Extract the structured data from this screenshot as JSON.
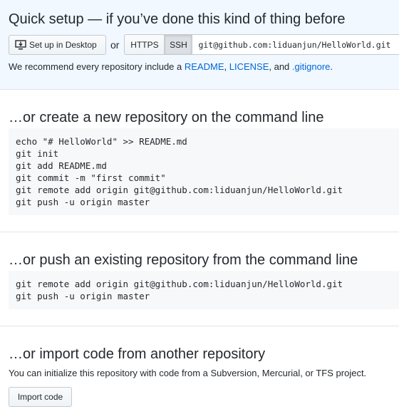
{
  "quick_setup": {
    "title": "Quick setup — if you’ve done this kind of thing before",
    "desktop_button": "Set up in Desktop",
    "or_text": "or",
    "protocols": [
      "HTTPS",
      "SSH"
    ],
    "selected_protocol": "SSH",
    "clone_url": "git@github.com:liduanjun/HelloWorld.git",
    "recommend": {
      "prefix": "We recommend every repository include a ",
      "readme": "README",
      "sep1": ", ",
      "license": "LICENSE",
      "sep2": ", and ",
      "gitignore": ".gitignore",
      "suffix": "."
    }
  },
  "create_section": {
    "title": "…or create a new repository on the command line",
    "lines": [
      "echo \"# HelloWorld\" >> README.md",
      "git init",
      "git add README.md",
      "git commit -m \"first commit\"",
      "git remote add origin git@github.com:liduanjun/HelloWorld.git",
      "git push -u origin master"
    ]
  },
  "push_section": {
    "title": "…or push an existing repository from the command line",
    "lines": [
      "git remote add origin git@github.com:liduanjun/HelloWorld.git",
      "git push -u origin master"
    ]
  },
  "import_section": {
    "title": "…or import code from another repository",
    "description": "You can initialize this repository with code from a Subversion, Mercurial, or TFS project.",
    "button": "Import code"
  },
  "icons": {
    "desktop": "desktop-download-icon"
  }
}
